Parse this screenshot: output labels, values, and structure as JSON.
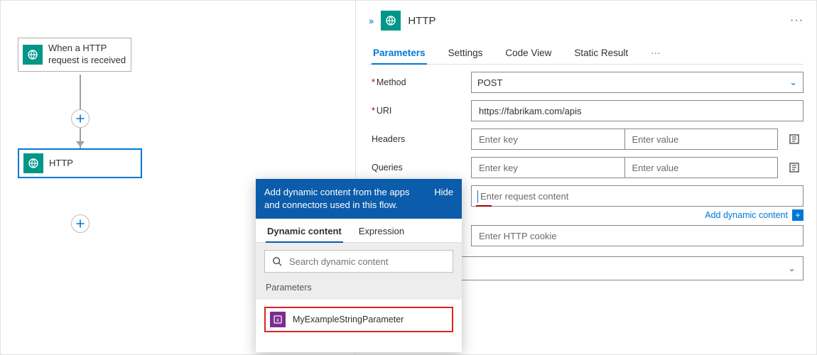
{
  "canvas": {
    "trigger": {
      "label": "When a HTTP request is received",
      "icon": "http-request-icon"
    },
    "action": {
      "label": "HTTP",
      "icon": "http-icon"
    }
  },
  "panel": {
    "title": "HTTP",
    "tabs": [
      "Parameters",
      "Settings",
      "Code View",
      "Static Result"
    ],
    "tabs_ellipsis": "···",
    "active_tab": 0,
    "labels": {
      "method": "Method",
      "uri": "URI",
      "headers": "Headers",
      "queries": "Queries"
    },
    "method": {
      "value": "POST"
    },
    "uri": {
      "value": "https://fabrikam.com/apis"
    },
    "headers": {
      "key_placeholder": "Enter key",
      "value_placeholder": "Enter value"
    },
    "queries": {
      "key_placeholder": "Enter key",
      "value_placeholder": "Enter value"
    },
    "body": {
      "placeholder": "Enter request content"
    },
    "cookie": {
      "placeholder": "Enter HTTP cookie"
    },
    "add_dynamic_label": "Add dynamic content"
  },
  "popover": {
    "banner_text": "Add dynamic content from the apps and connectors used in this flow.",
    "hide_label": "Hide",
    "tabs": [
      "Dynamic content",
      "Expression"
    ],
    "active_tab": 0,
    "search_placeholder": "Search dynamic content",
    "section_title": "Parameters",
    "items": [
      {
        "label": "MyExampleStringParameter",
        "icon": "parameter-icon",
        "highlight": true
      }
    ]
  }
}
